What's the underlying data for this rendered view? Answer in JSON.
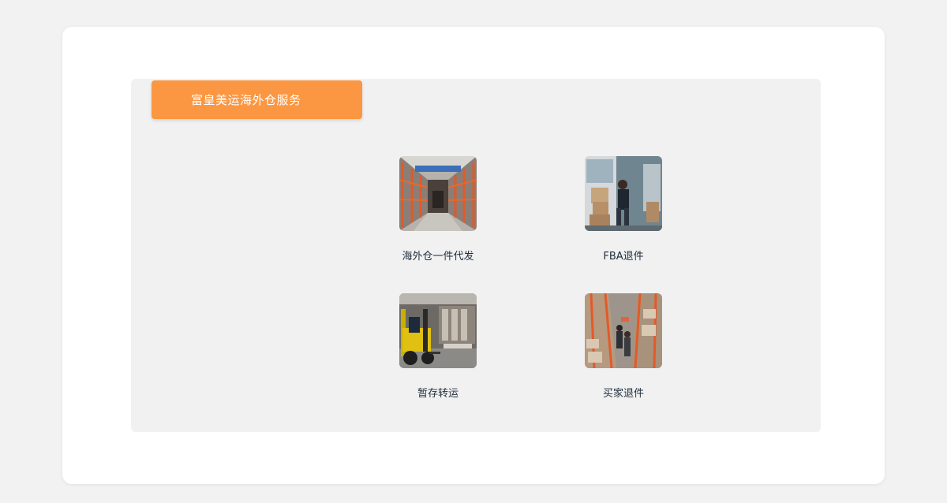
{
  "panel": {
    "title": "富皇美运海外仓服务",
    "accent_color": "#fb9742"
  },
  "services": [
    {
      "label": "海外仓一件代发",
      "icon": "warehouse-aisle-photo"
    },
    {
      "label": "FBA退件",
      "icon": "delivery-van-photo"
    },
    {
      "label": "暂存转运",
      "icon": "forklift-photo"
    },
    {
      "label": "买家退件",
      "icon": "warehouse-workers-photo"
    }
  ]
}
